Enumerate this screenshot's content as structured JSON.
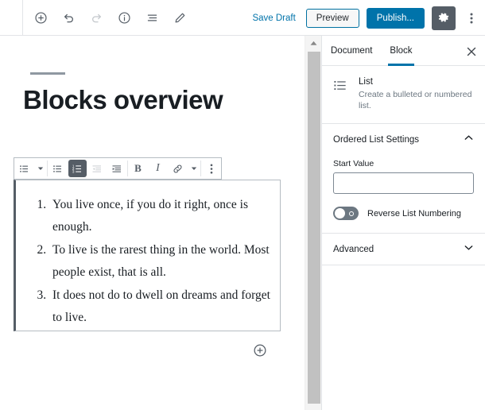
{
  "header": {
    "left_tools": [
      {
        "name": "add-block-icon",
        "label": "Add block"
      },
      {
        "name": "undo-icon",
        "label": "Undo"
      },
      {
        "name": "redo-icon",
        "label": "Redo"
      },
      {
        "name": "content-info-icon",
        "label": "Content structure"
      },
      {
        "name": "block-navigation-icon",
        "label": "Block navigation"
      },
      {
        "name": "edit-pencil-icon",
        "label": "Edit"
      }
    ],
    "save_draft_label": "Save Draft",
    "preview_label": "Preview",
    "publish_label": "Publish...",
    "settings_icon": "gear-icon",
    "more_icon": "vertical-ellipsis-icon",
    "publish_color": "#0073aa"
  },
  "editor": {
    "title": "Blocks overview",
    "block_toolbar": {
      "block_type_label": "List",
      "buttons": [
        {
          "name": "block-type-switcher",
          "icon": "list-icon"
        },
        {
          "name": "block-type-dropdown",
          "icon": "chevron-down-icon"
        },
        {
          "name": "unordered-list-button",
          "icon": "unordered-list-icon",
          "state": "normal"
        },
        {
          "name": "ordered-list-button",
          "icon": "ordered-list-icon",
          "state": "active"
        },
        {
          "name": "outdent-button",
          "icon": "outdent-icon",
          "state": "disabled"
        },
        {
          "name": "indent-button",
          "icon": "indent-icon",
          "state": "normal"
        },
        {
          "name": "bold-button",
          "icon": "bold-icon",
          "label": "B"
        },
        {
          "name": "italic-button",
          "icon": "italic-icon",
          "label": "I"
        },
        {
          "name": "link-button",
          "icon": "link-icon"
        },
        {
          "name": "formatting-dropdown",
          "icon": "chevron-down-icon"
        },
        {
          "name": "more-options-button",
          "icon": "vertical-ellipsis-icon"
        }
      ]
    },
    "list_items": [
      "You live once, if you do it right, once is enough.",
      "To live is the rarest thing in the world. Most people exist, that is all.",
      "It does not do to dwell on dreams and forget to live."
    ],
    "inserter_icon": "circle-plus-icon"
  },
  "sidebar": {
    "tabs": [
      {
        "label": "Document",
        "active": false
      },
      {
        "label": "Block",
        "active": true
      }
    ],
    "close_icon": "close-icon",
    "active_color": "#0073aa",
    "block_info": {
      "icon": "list-icon",
      "title": "List",
      "description": "Create a bulleted or numbered list."
    },
    "panels": [
      {
        "title": "Ordered List Settings",
        "expanded": true,
        "chevron": "chevron-up-icon",
        "start_value": {
          "label": "Start Value",
          "value": "",
          "placeholder": ""
        },
        "reverse_toggle": {
          "label": "Reverse List Numbering",
          "checked": false
        }
      },
      {
        "title": "Advanced",
        "expanded": false,
        "chevron": "chevron-down-icon"
      }
    ]
  }
}
